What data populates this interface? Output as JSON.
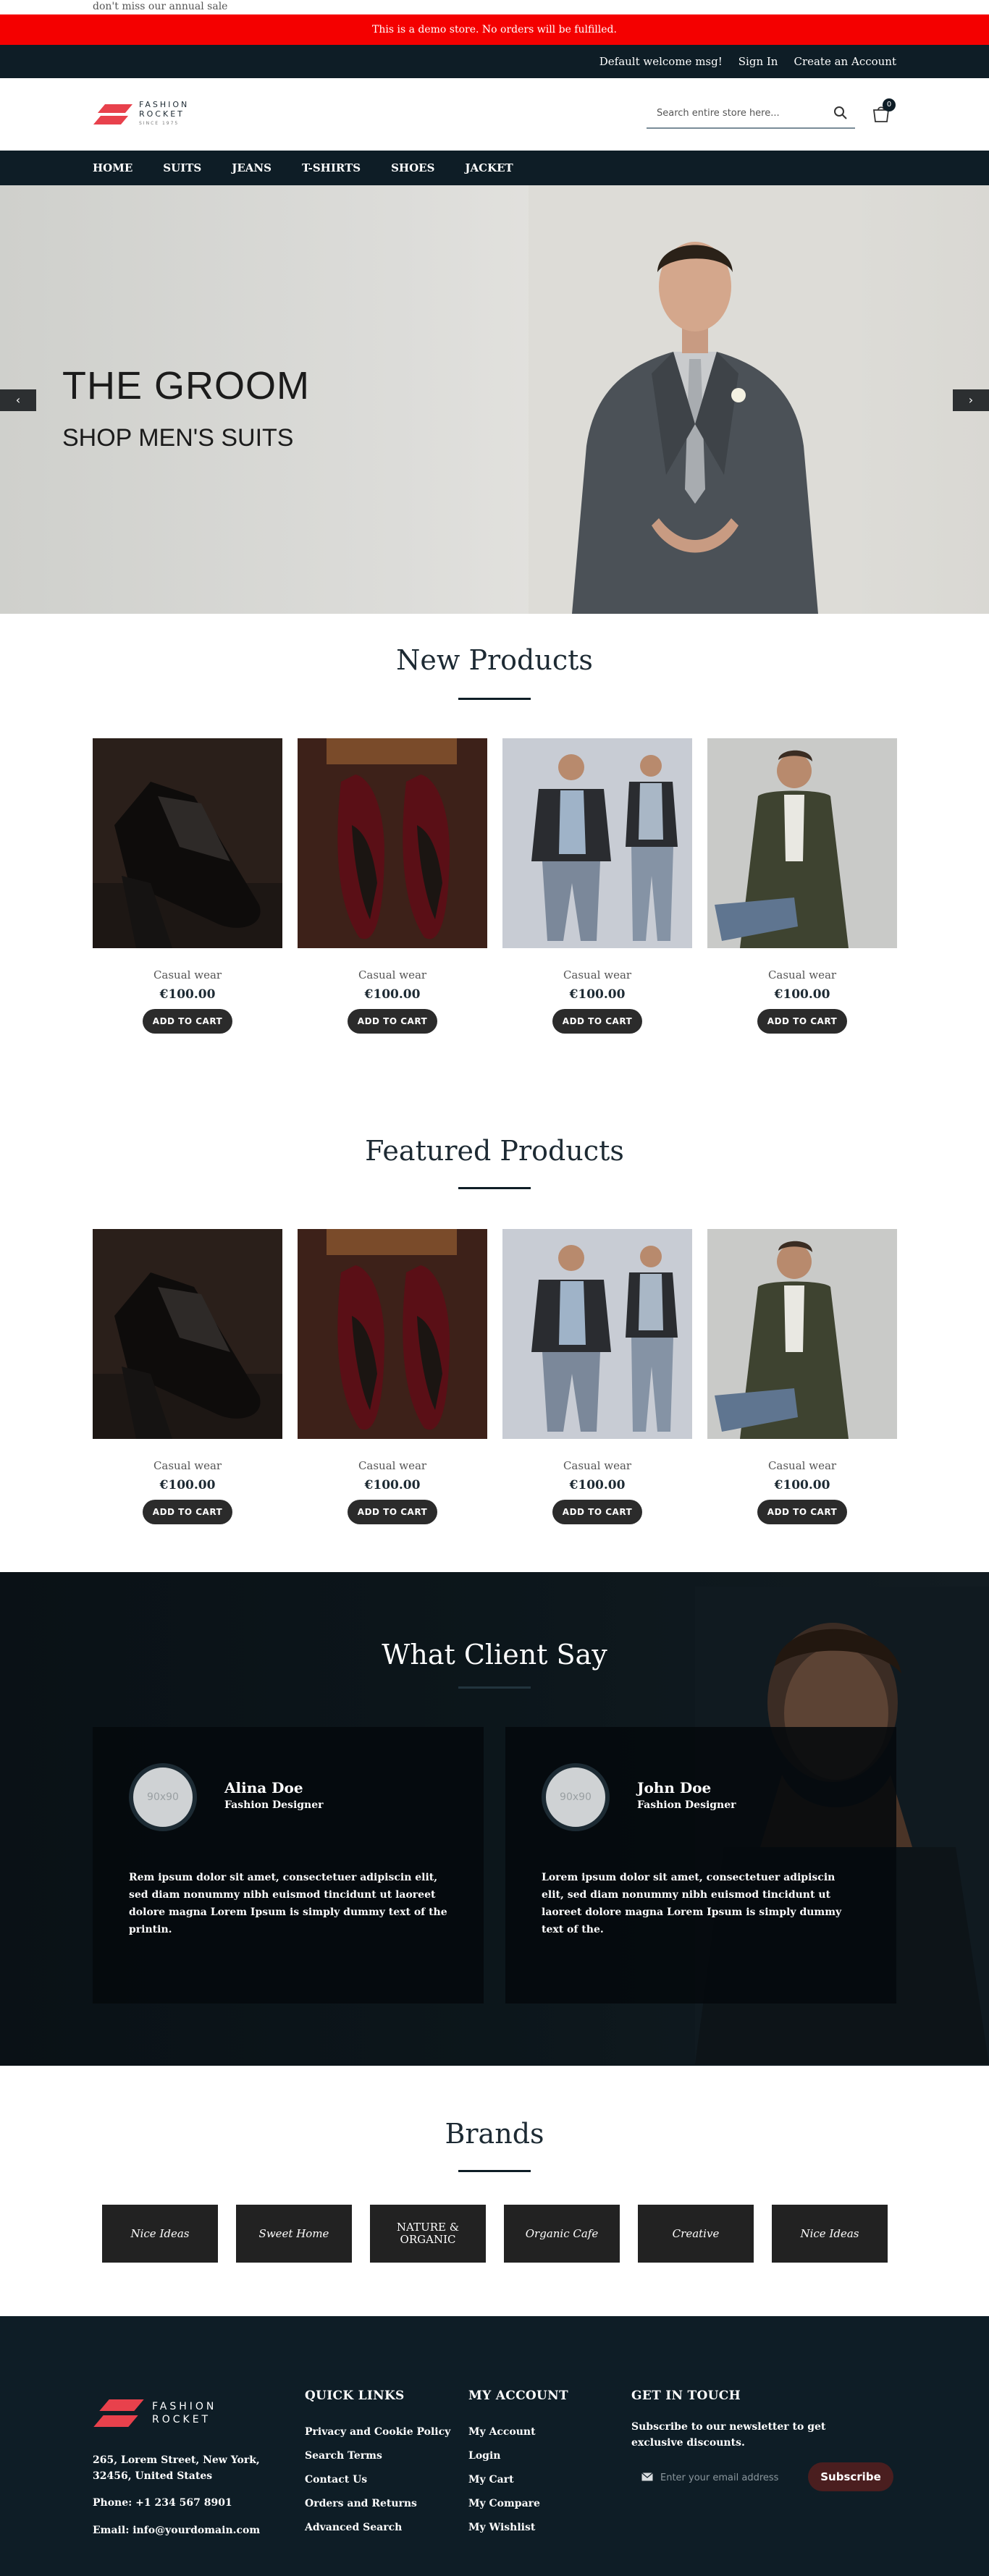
{
  "promo": {
    "text": "don't miss our annual sale"
  },
  "demo_notice": "This is a demo store. No orders will be fulfilled.",
  "top_links": {
    "welcome": "Default welcome msg!",
    "sign_in": "Sign In",
    "create_account": "Create an Account"
  },
  "logo": {
    "line1": "FASHION",
    "line2": "ROCKET",
    "tagline": "SINCE 1975"
  },
  "search": {
    "placeholder": "Search entire store here..."
  },
  "cart": {
    "count": "0"
  },
  "nav": {
    "items": [
      "HOME",
      "SUITS",
      "JEANS",
      "T-SHIRTS",
      "SHOES",
      "JACKET"
    ]
  },
  "hero": {
    "title": "THE GROOM",
    "subtitle": "SHOP MEN'S SUITS",
    "prev": "‹",
    "next": "›"
  },
  "new_products": {
    "title": "New Products",
    "items": [
      {
        "name": "Casual wear",
        "price": "€100.00",
        "button": "ADD TO CART"
      },
      {
        "name": "Casual wear",
        "price": "€100.00",
        "button": "ADD TO CART"
      },
      {
        "name": "Casual wear",
        "price": "€100.00",
        "button": "ADD TO CART"
      },
      {
        "name": "Casual wear",
        "price": "€100.00",
        "button": "ADD TO CART"
      }
    ]
  },
  "featured_products": {
    "title": "Featured Products",
    "items": [
      {
        "name": "Casual wear",
        "price": "€100.00",
        "button": "ADD TO CART"
      },
      {
        "name": "Casual wear",
        "price": "€100.00",
        "button": "ADD TO CART"
      },
      {
        "name": "Casual wear",
        "price": "€100.00",
        "button": "ADD TO CART"
      },
      {
        "name": "Casual wear",
        "price": "€100.00",
        "button": "ADD TO CART"
      }
    ]
  },
  "testimonials": {
    "title": "What Client Say",
    "items": [
      {
        "avatar": "90x90",
        "name": "Alina Doe",
        "role": "Fashion Designer",
        "quote": "Rem ipsum dolor sit amet, consectetuer adipiscin elit, sed diam nonummy nibh euismod tincidunt ut laoreet dolore magna Lorem Ipsum is simply dummy text of the printin."
      },
      {
        "avatar": "90x90",
        "name": "John Doe",
        "role": "Fashion Designer",
        "quote": "Lorem ipsum dolor sit amet, consectetuer adipiscin elit, sed diam nonummy nibh euismod tincidunt ut laoreet dolore magna Lorem Ipsum is simply dummy text of the."
      }
    ]
  },
  "brands": {
    "title": "Brands",
    "items": [
      "Nice Ideas",
      "Sweet Home",
      "NATURE & ORGANIC",
      "Organic Cafe",
      "Creative",
      "Nice Ideas"
    ]
  },
  "footer": {
    "logo_line1": "FASHION",
    "logo_line2": "ROCKET",
    "address": "265, Lorem Street, New York, 32456, United States",
    "phone": "Phone: +1 234 567 8901",
    "email": "Email: info@yourdomain.com",
    "quick_links": {
      "title": "QUICK LINKS",
      "items": [
        "Privacy and Cookie Policy",
        "Search Terms",
        "Contact Us",
        "Orders and Returns",
        "Advanced Search"
      ]
    },
    "my_account": {
      "title": "MY ACCOUNT",
      "items": [
        "My Account",
        "Login",
        "My Cart",
        "My Compare",
        "My Wishlist"
      ]
    },
    "get_in_touch": {
      "title": "GET IN TOUCH",
      "text": "Subscribe to our newsletter to get exclusive discounts.",
      "placeholder": "Enter your email address",
      "button": "Subscribe"
    }
  },
  "colors": {
    "dark": "#0e1d26",
    "demo_red": "#f40000",
    "logo_red": "#e8414c",
    "subscribe": "#4a1e1f"
  }
}
